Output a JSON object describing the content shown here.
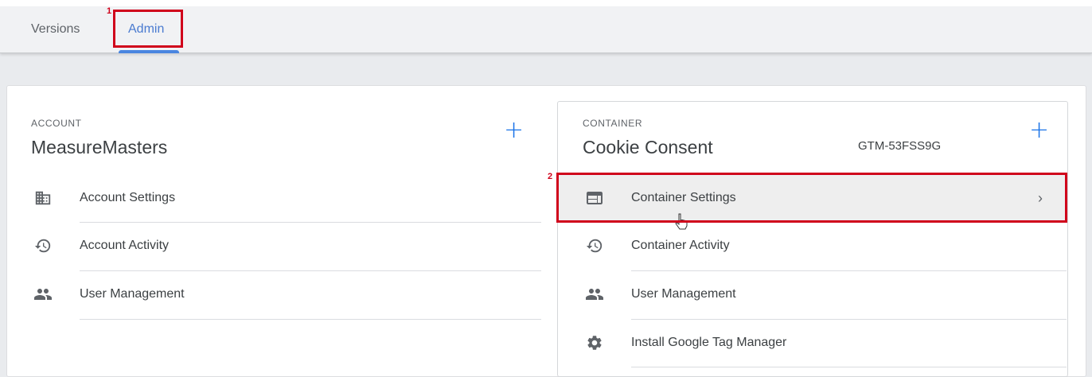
{
  "tabs": [
    {
      "label": "Versions"
    },
    {
      "label": "Admin"
    }
  ],
  "annotations": {
    "first": "1",
    "second": "2"
  },
  "account": {
    "section_label": "ACCOUNT",
    "name": "MeasureMasters",
    "add_icon": "plus-icon",
    "items": [
      {
        "label": "Account Settings",
        "icon": "building-icon"
      },
      {
        "label": "Account Activity",
        "icon": "history-icon"
      },
      {
        "label": "User Management",
        "icon": "people-icon"
      }
    ]
  },
  "container": {
    "section_label": "CONTAINER",
    "name": "Cookie Consent",
    "id": "GTM-53FSS9G",
    "add_icon": "plus-icon",
    "items": [
      {
        "label": "Container Settings",
        "icon": "web-window-icon"
      },
      {
        "label": "Container Activity",
        "icon": "history-icon"
      },
      {
        "label": "User Management",
        "icon": "people-icon"
      },
      {
        "label": "Install Google Tag Manager",
        "icon": "gear-icon"
      }
    ]
  },
  "colors": {
    "accent": "#1a73e8",
    "annotation": "#d0021b",
    "active_tab": "#4a7bd0"
  }
}
